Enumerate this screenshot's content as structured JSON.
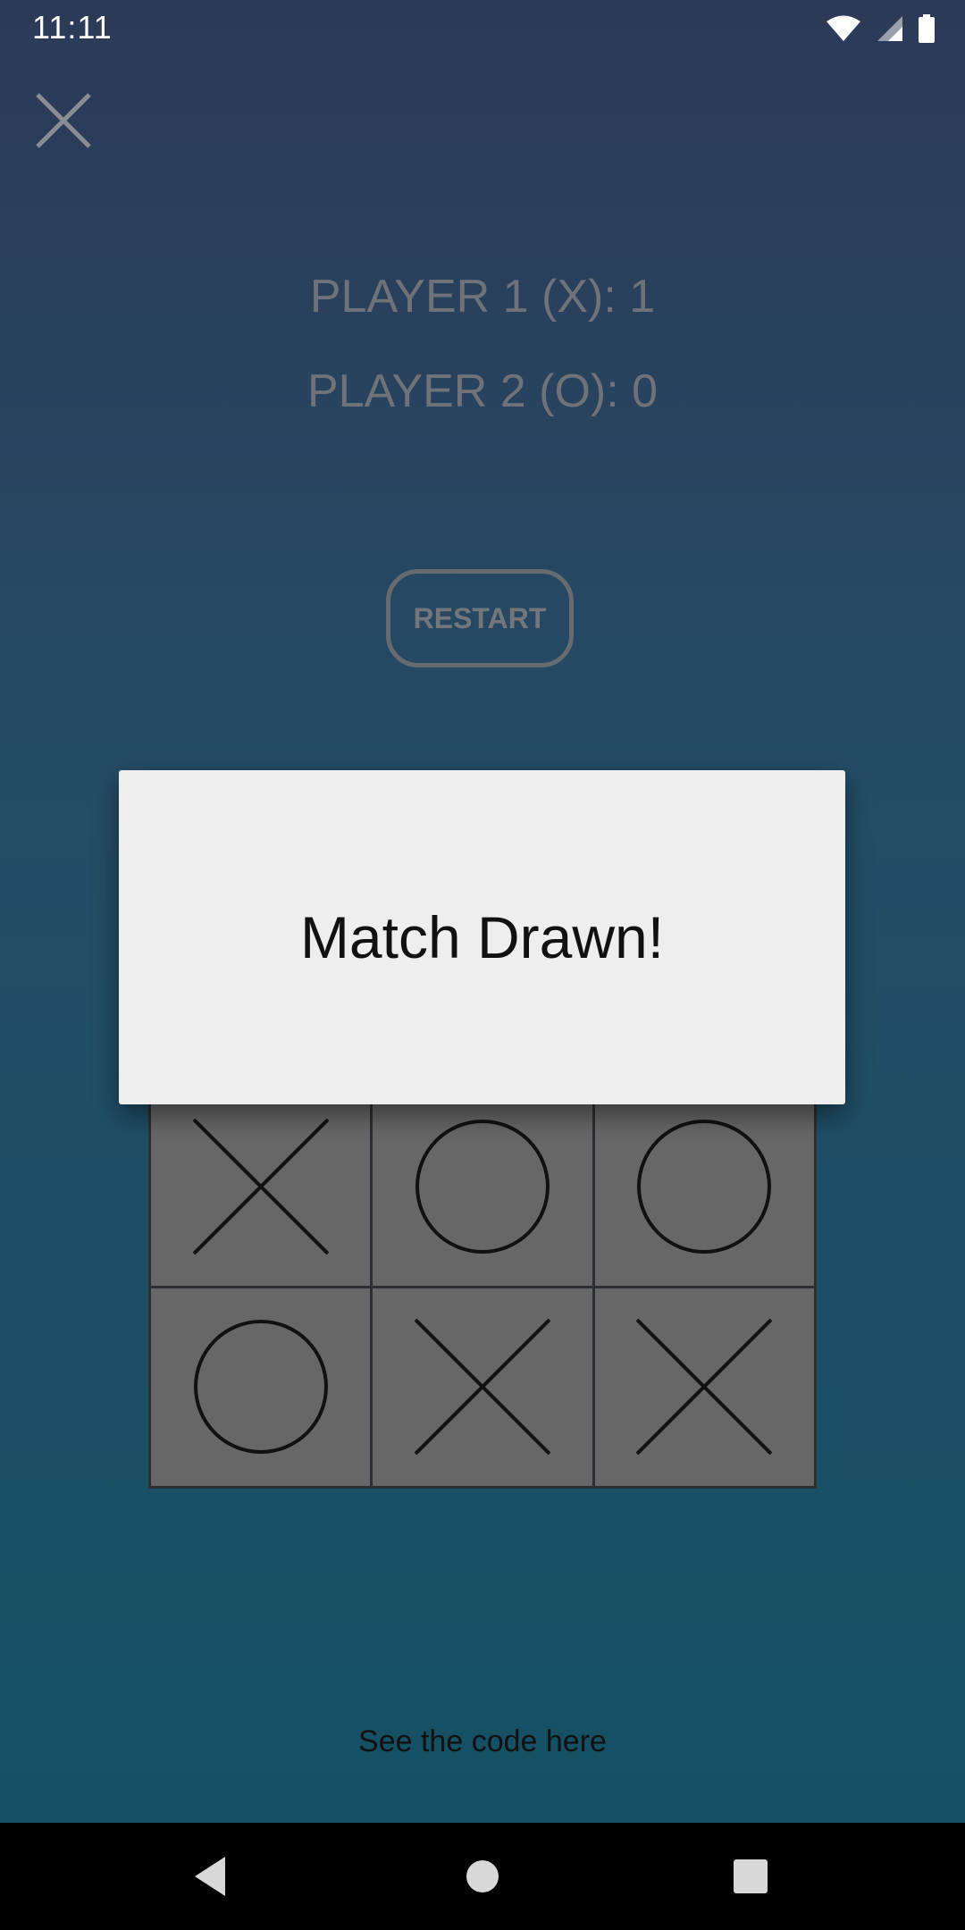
{
  "status_bar": {
    "time": "11:11",
    "icons": [
      "wifi-icon",
      "signal-icon",
      "battery-icon"
    ]
  },
  "header": {
    "close_icon": "close-icon"
  },
  "scores": {
    "player1": "PLAYER 1 (X): 1",
    "player2": "PLAYER 2 (O): 0"
  },
  "restart": {
    "label": "RESTART"
  },
  "board": {
    "visible_rows": [
      [
        "X",
        "O",
        "O"
      ],
      [
        "O",
        "X",
        "X"
      ]
    ],
    "note_hidden_top_row": true
  },
  "dialog": {
    "message": "Match Drawn!"
  },
  "footer": {
    "link_text": "See the code here"
  },
  "nav_bar": {
    "buttons": [
      "back-icon",
      "home-icon",
      "recents-icon"
    ]
  },
  "colors": {
    "background_top": "#2c3a58",
    "background_bottom": "#145064",
    "cell": "#676767",
    "dialog_bg": "#eeeeee",
    "muted_text": "#6f7278"
  }
}
